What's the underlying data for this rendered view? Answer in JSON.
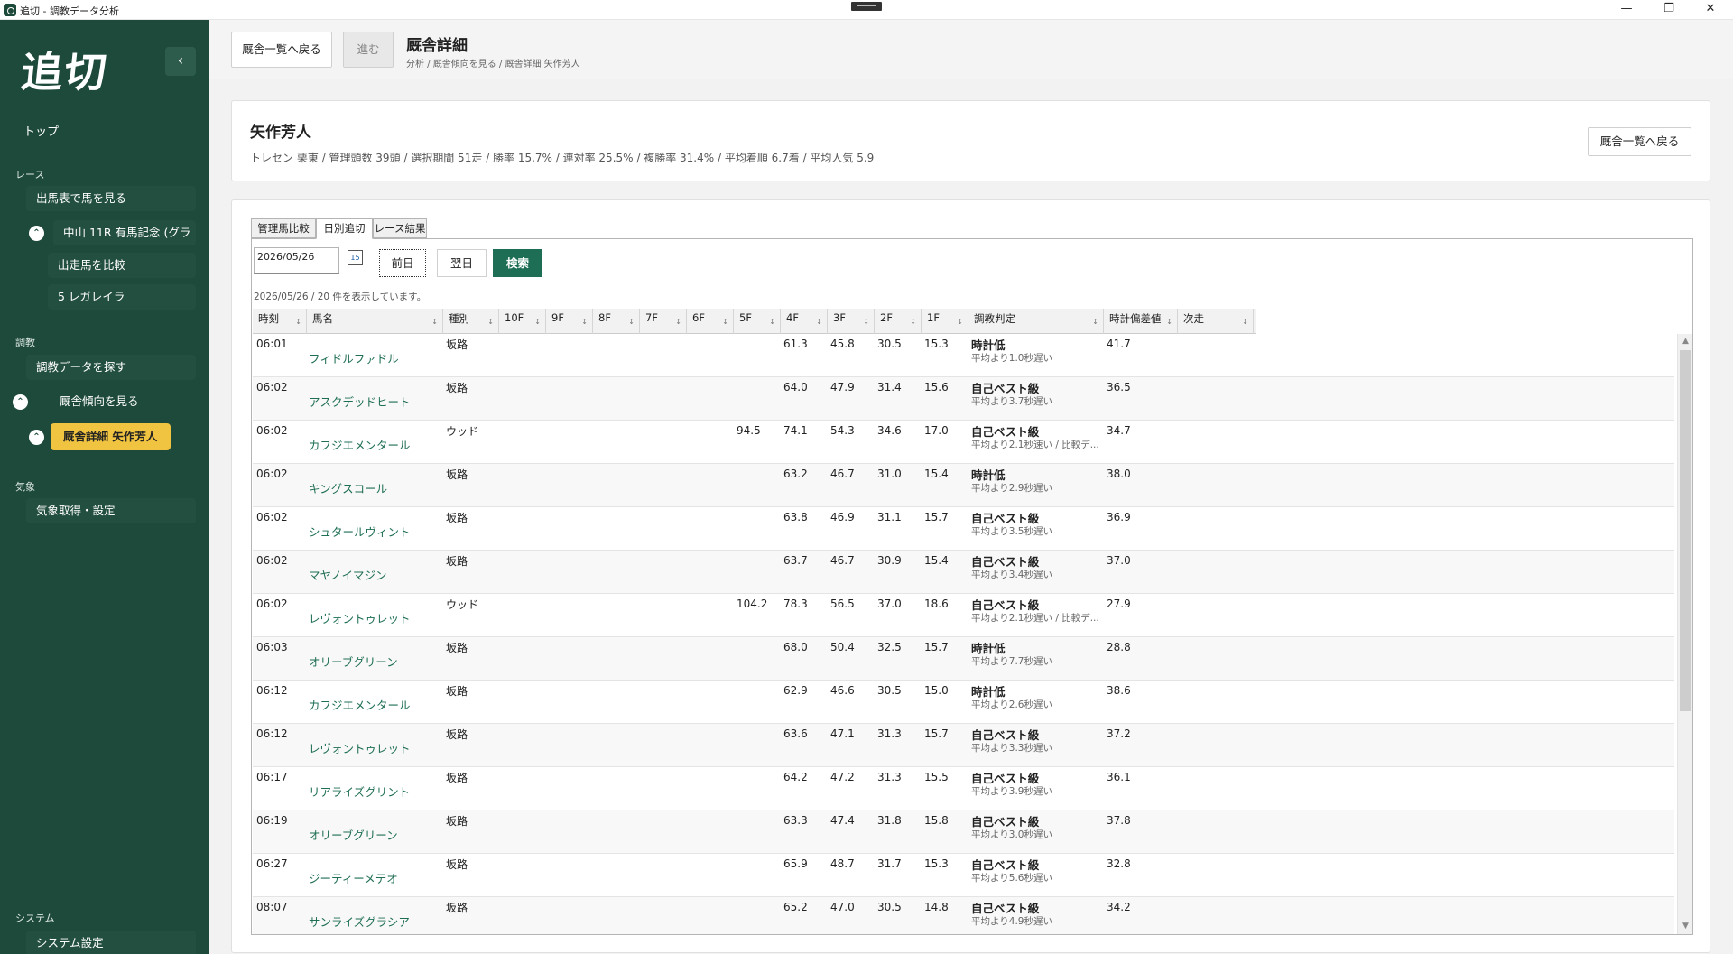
{
  "window": {
    "title": "追切 - 調教データ分析",
    "minimize": "—",
    "maximize": "❐",
    "close": "✕"
  },
  "sidebar": {
    "logo": "追切",
    "collapse_icon": "‹",
    "top": "トップ",
    "sections": {
      "race": "レース",
      "training": "調教",
      "weather": "気象",
      "system": "システム"
    },
    "items": {
      "race_card": "出馬表で馬を見る",
      "race_name": "中山 11R 有馬記念 (グラ",
      "compare": "出走馬を比較",
      "horse": "5 レガレイラ",
      "search_training": "調教データを探す",
      "stable_trend": "厩舎傾向を見る",
      "stable_detail": "厩舎詳細 矢作芳人",
      "weather_setting": "気象取得・設定",
      "system_setting": "システム設定"
    }
  },
  "header": {
    "back_label": "厩舎一覧へ戻る",
    "forward_label": "進む",
    "title": "厩舎詳細",
    "breadcrumb": "分析 / 厩舎傾向を見る / 厩舎詳細 矢作芳人"
  },
  "trainer": {
    "name": "矢作芳人",
    "stats": "トレセン 栗東 / 管理頭数 39頭 / 選択期間 51走 / 勝率 15.7% / 連対率 25.5% / 複勝率 31.4% / 平均着順 6.7着 / 平均人気 5.9",
    "back_label": "厩舎一覧へ戻る"
  },
  "tabs": [
    "管理馬比較",
    "日別追切",
    "レース結果"
  ],
  "active_tab": 1,
  "toolbar": {
    "date_value": "2026/05/26",
    "calendar_day": "15",
    "prev_label": "前日",
    "next_label": "翌日",
    "search_label": "検索",
    "count_text": "2026/05/26 / 20 件を表示しています。"
  },
  "columns": [
    "時刻",
    "馬名",
    "種別",
    "10F",
    "9F",
    "8F",
    "7F",
    "6F",
    "5F",
    "4F",
    "3F",
    "2F",
    "1F",
    "調教判定",
    "時計偏差値",
    "次走"
  ],
  "rows": [
    {
      "time": "06:01",
      "horse": "フィドルファドル",
      "kind": "坂路",
      "f5": "",
      "f4": "61.3",
      "f3": "45.8",
      "f2": "30.5",
      "f1": "15.3",
      "judge": "時計低",
      "judge_sub": "平均より1.0秒遅い",
      "dev": "41.7"
    },
    {
      "time": "06:02",
      "horse": "アスクデッドヒート",
      "kind": "坂路",
      "f5": "",
      "f4": "64.0",
      "f3": "47.9",
      "f2": "31.4",
      "f1": "15.6",
      "judge": "自己ベスト級",
      "judge_sub": "平均より3.7秒遅い",
      "dev": "36.5"
    },
    {
      "time": "06:02",
      "horse": "カフジエメンタール",
      "kind": "ウッド",
      "f5": "94.5",
      "f4": "74.1",
      "f3": "54.3",
      "f2": "34.6",
      "f1": "17.0",
      "judge": "自己ベスト級",
      "judge_sub": "平均より2.1秒速い / 比較デ...",
      "dev": "34.7"
    },
    {
      "time": "06:02",
      "horse": "キングスコール",
      "kind": "坂路",
      "f5": "",
      "f4": "63.2",
      "f3": "46.7",
      "f2": "31.0",
      "f1": "15.4",
      "judge": "時計低",
      "judge_sub": "平均より2.9秒遅い",
      "dev": "38.0"
    },
    {
      "time": "06:02",
      "horse": "シュタールヴィント",
      "kind": "坂路",
      "f5": "",
      "f4": "63.8",
      "f3": "46.9",
      "f2": "31.1",
      "f1": "15.7",
      "judge": "自己ベスト級",
      "judge_sub": "平均より3.5秒遅い",
      "dev": "36.9"
    },
    {
      "time": "06:02",
      "horse": "マヤノイマジン",
      "kind": "坂路",
      "f5": "",
      "f4": "63.7",
      "f3": "46.7",
      "f2": "30.9",
      "f1": "15.4",
      "judge": "自己ベスト級",
      "judge_sub": "平均より3.4秒遅い",
      "dev": "37.0"
    },
    {
      "time": "06:02",
      "horse": "レヴォントゥレット",
      "kind": "ウッド",
      "f5": "104.2",
      "f4": "78.3",
      "f3": "56.5",
      "f2": "37.0",
      "f1": "18.6",
      "judge": "自己ベスト級",
      "judge_sub": "平均より2.1秒遅い / 比較デ...",
      "dev": "27.9"
    },
    {
      "time": "06:03",
      "horse": "オリーブグリーン",
      "kind": "坂路",
      "f5": "",
      "f4": "68.0",
      "f3": "50.4",
      "f2": "32.5",
      "f1": "15.7",
      "judge": "時計低",
      "judge_sub": "平均より7.7秒遅い",
      "dev": "28.8"
    },
    {
      "time": "06:12",
      "horse": "カフジエメンタール",
      "kind": "坂路",
      "f5": "",
      "f4": "62.9",
      "f3": "46.6",
      "f2": "30.5",
      "f1": "15.0",
      "judge": "時計低",
      "judge_sub": "平均より2.6秒遅い",
      "dev": "38.6"
    },
    {
      "time": "06:12",
      "horse": "レヴォントゥレット",
      "kind": "坂路",
      "f5": "",
      "f4": "63.6",
      "f3": "47.1",
      "f2": "31.3",
      "f1": "15.7",
      "judge": "自己ベスト級",
      "judge_sub": "平均より3.3秒遅い",
      "dev": "37.2"
    },
    {
      "time": "06:17",
      "horse": "リアライズグリント",
      "kind": "坂路",
      "f5": "",
      "f4": "64.2",
      "f3": "47.2",
      "f2": "31.3",
      "f1": "15.5",
      "judge": "自己ベスト級",
      "judge_sub": "平均より3.9秒遅い",
      "dev": "36.1"
    },
    {
      "time": "06:19",
      "horse": "オリーブグリーン",
      "kind": "坂路",
      "f5": "",
      "f4": "63.3",
      "f3": "47.4",
      "f2": "31.8",
      "f1": "15.8",
      "judge": "自己ベスト級",
      "judge_sub": "平均より3.0秒遅い",
      "dev": "37.8"
    },
    {
      "time": "06:27",
      "horse": "ジーティーメテオ",
      "kind": "坂路",
      "f5": "",
      "f4": "65.9",
      "f3": "48.7",
      "f2": "31.7",
      "f1": "15.3",
      "judge": "自己ベスト級",
      "judge_sub": "平均より5.6秒遅い",
      "dev": "32.8"
    },
    {
      "time": "08:07",
      "horse": "サンライズグラシア",
      "kind": "坂路",
      "f5": "",
      "f4": "65.2",
      "f3": "47.0",
      "f2": "30.5",
      "f1": "14.8",
      "judge": "自己ベスト級",
      "judge_sub": "平均より4.9秒遅い",
      "dev": "34.2"
    }
  ],
  "icons": {
    "sort": "sort-arrows-icon",
    "calendar": "calendar-icon",
    "expand": "chevron-up-circle-icon"
  },
  "colors": {
    "sidebar": "#1e4a3c",
    "active_nav": "#f0c340",
    "primary": "#1e6e55",
    "horse_link": "#1e6e55"
  }
}
